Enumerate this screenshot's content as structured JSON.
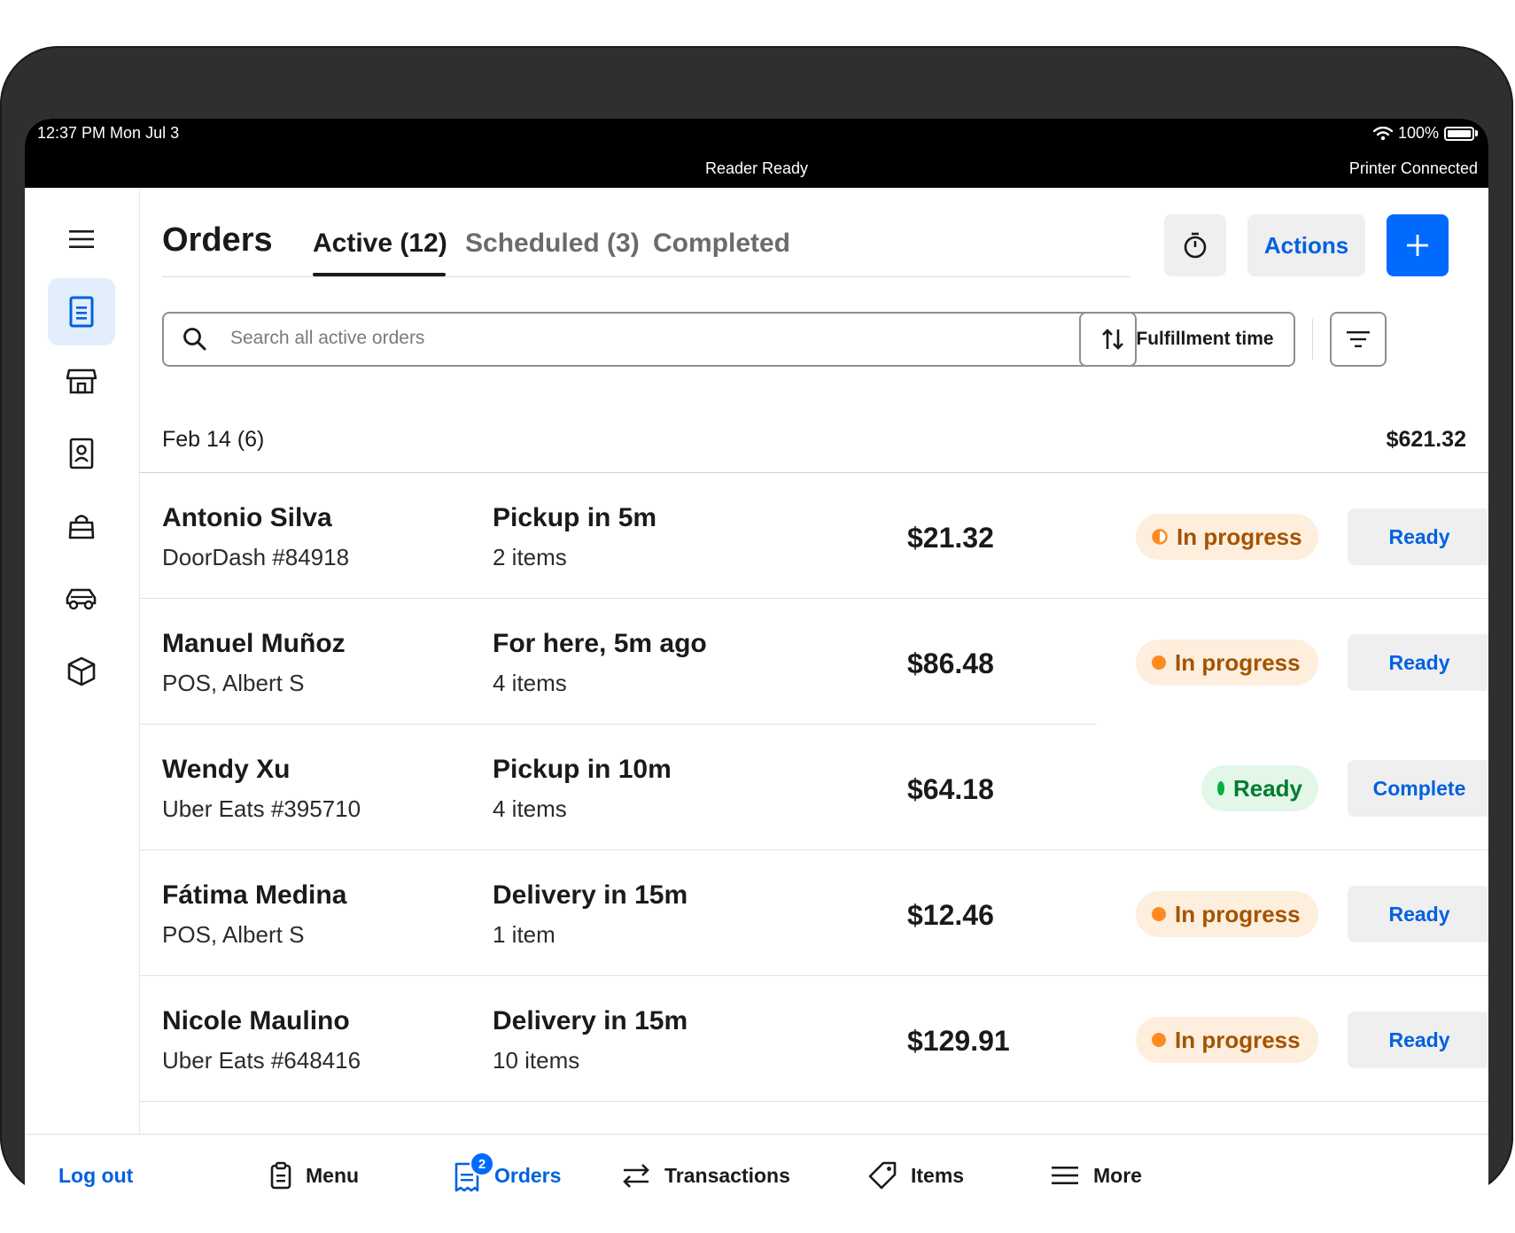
{
  "status_bar": {
    "time": "12:37 PM  Mon Jul 3",
    "battery": "100%",
    "reader": "Reader Ready",
    "printer": "Printer Connected"
  },
  "sidebar": {
    "items": [
      {
        "icon": "hamburger-icon"
      },
      {
        "icon": "receipt-icon",
        "active": true
      },
      {
        "icon": "storefront-icon"
      },
      {
        "icon": "customer-directory-icon"
      },
      {
        "icon": "shopping-bag-icon"
      },
      {
        "icon": "car-icon"
      },
      {
        "icon": "box-icon"
      }
    ]
  },
  "header": {
    "title": "Orders",
    "tabs": [
      {
        "label": "Active (12)"
      },
      {
        "label": "Scheduled (3)"
      },
      {
        "label": "Completed"
      }
    ],
    "timer_icon": "stopwatch-icon",
    "actions_label": "Actions",
    "add_icon": "plus-icon"
  },
  "search": {
    "placeholder": "Search all active orders",
    "sort_label": "Fulfillment time"
  },
  "group": {
    "label": "Feb 14 (6)",
    "total": "$621.32"
  },
  "orders": [
    {
      "name": "Antonio Silva",
      "source": "DoorDash #84918",
      "when": "Pickup in 5m",
      "items": "2 items",
      "amount": "$21.32",
      "status": "In progress",
      "action": "Ready"
    },
    {
      "name": "Manuel Muñoz",
      "source": "POS, Albert S",
      "when": "For here, 5m ago",
      "items": "4 items",
      "amount": "$86.48",
      "status": "In progress",
      "action": "Ready"
    },
    {
      "name": "Wendy Xu",
      "source": "Uber Eats #395710",
      "when": "Pickup in 10m",
      "items": "4 items",
      "amount": "$64.18",
      "status": "Ready",
      "action": "Complete"
    },
    {
      "name": "Fátima Medina",
      "source": "POS, Albert S",
      "when": "Delivery in 15m",
      "items": "1 item",
      "amount": "$12.46",
      "status": "In progress",
      "action": "Ready"
    },
    {
      "name": "Nicole Maulino",
      "source": "Uber Eats #648416",
      "when": "Delivery in 15m",
      "items": "10 items",
      "amount": "$129.91",
      "status": "In progress",
      "action": "Ready"
    }
  ],
  "colors": {
    "accent": "#006aff",
    "link": "#0061e0",
    "progress_dot": "#ff8a1f",
    "ready_dot": "#00b23b"
  },
  "bottom_nav": {
    "logout": "Log out",
    "items": [
      {
        "label": "Menu",
        "icon": "clipboard-icon"
      },
      {
        "label": "Orders",
        "icon": "orders-receipt-icon",
        "badge": "2",
        "active": true
      },
      {
        "label": "Transactions",
        "icon": "transfer-arrows-icon"
      },
      {
        "label": "Items",
        "icon": "tag-icon"
      },
      {
        "label": "More",
        "icon": "menu-lines-icon"
      }
    ]
  }
}
